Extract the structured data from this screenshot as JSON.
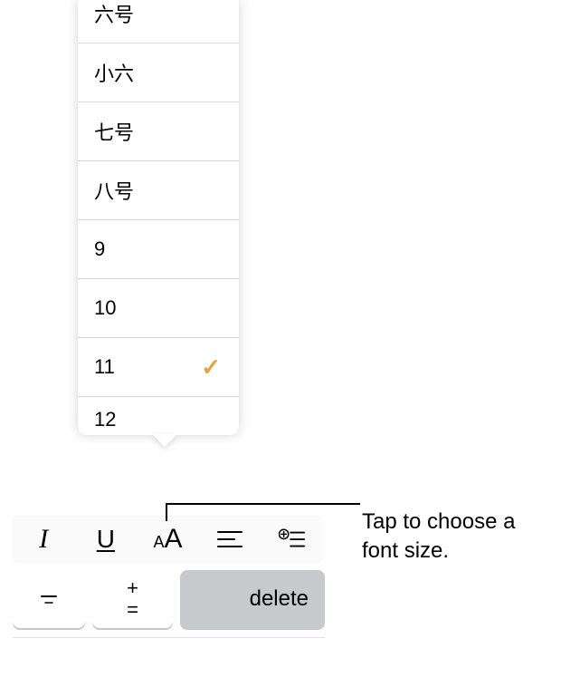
{
  "font_size_list": {
    "items": [
      {
        "label": "六号",
        "selected": false
      },
      {
        "label": "小六",
        "selected": false
      },
      {
        "label": "七号",
        "selected": false
      },
      {
        "label": "八号",
        "selected": false
      },
      {
        "label": "9",
        "selected": false
      },
      {
        "label": "10",
        "selected": false
      },
      {
        "label": "11",
        "selected": true
      },
      {
        "label": "12",
        "selected": false
      }
    ]
  },
  "toolbar": {
    "italic": "I",
    "underline": "U",
    "font_size_small": "A",
    "font_size_big": "A"
  },
  "keyboard": {
    "minus": "−",
    "plus": "+",
    "equals": "=",
    "delete": "delete"
  },
  "callout": {
    "text": "Tap to choose a font size."
  }
}
